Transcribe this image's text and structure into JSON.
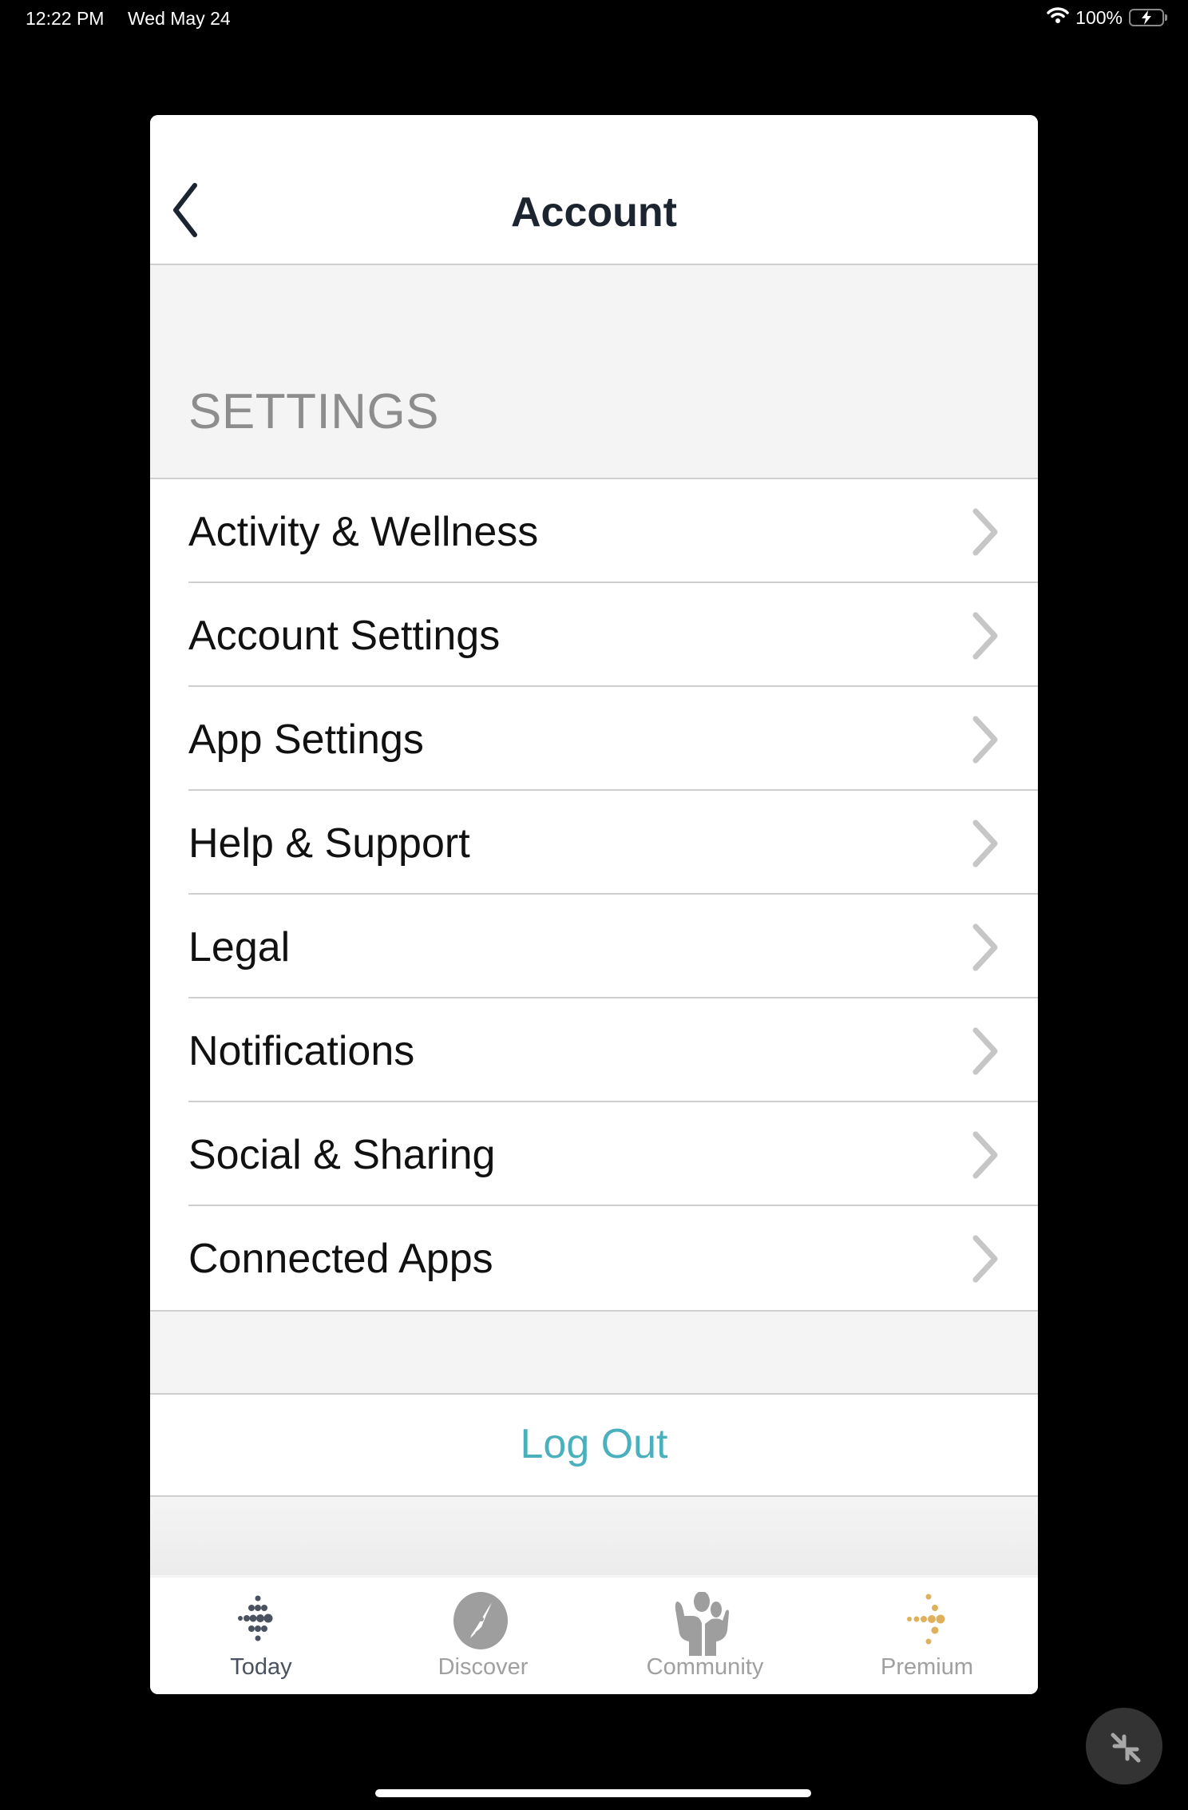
{
  "status_bar": {
    "time": "12:22 PM",
    "date": "Wed May 24",
    "battery_percent": "100%",
    "icons": [
      "wifi-icon",
      "battery-charging-icon"
    ]
  },
  "nav": {
    "title": "Account",
    "back_icon": "chevron-left-icon"
  },
  "settings": {
    "section_label": "SETTINGS",
    "items": [
      {
        "label": "Activity & Wellness"
      },
      {
        "label": "Account Settings"
      },
      {
        "label": "App Settings"
      },
      {
        "label": "Help & Support"
      },
      {
        "label": "Legal"
      },
      {
        "label": "Notifications"
      },
      {
        "label": "Social & Sharing"
      },
      {
        "label": "Connected Apps"
      }
    ]
  },
  "logout": {
    "label": "Log Out",
    "color": "#4bb0bd"
  },
  "tabbar": {
    "tabs": [
      {
        "label": "Today",
        "icon": "fitbit-dots-icon",
        "active": true
      },
      {
        "label": "Discover",
        "icon": "compass-icon",
        "active": false
      },
      {
        "label": "Community",
        "icon": "community-people-icon",
        "active": false
      },
      {
        "label": "Premium",
        "icon": "premium-dots-icon",
        "active": false
      }
    ]
  },
  "colors": {
    "accent": "#4bb0bd",
    "premium": "#e0b15c",
    "today_icon": "#4a5260",
    "inactive_icon": "#9e9e9e"
  }
}
